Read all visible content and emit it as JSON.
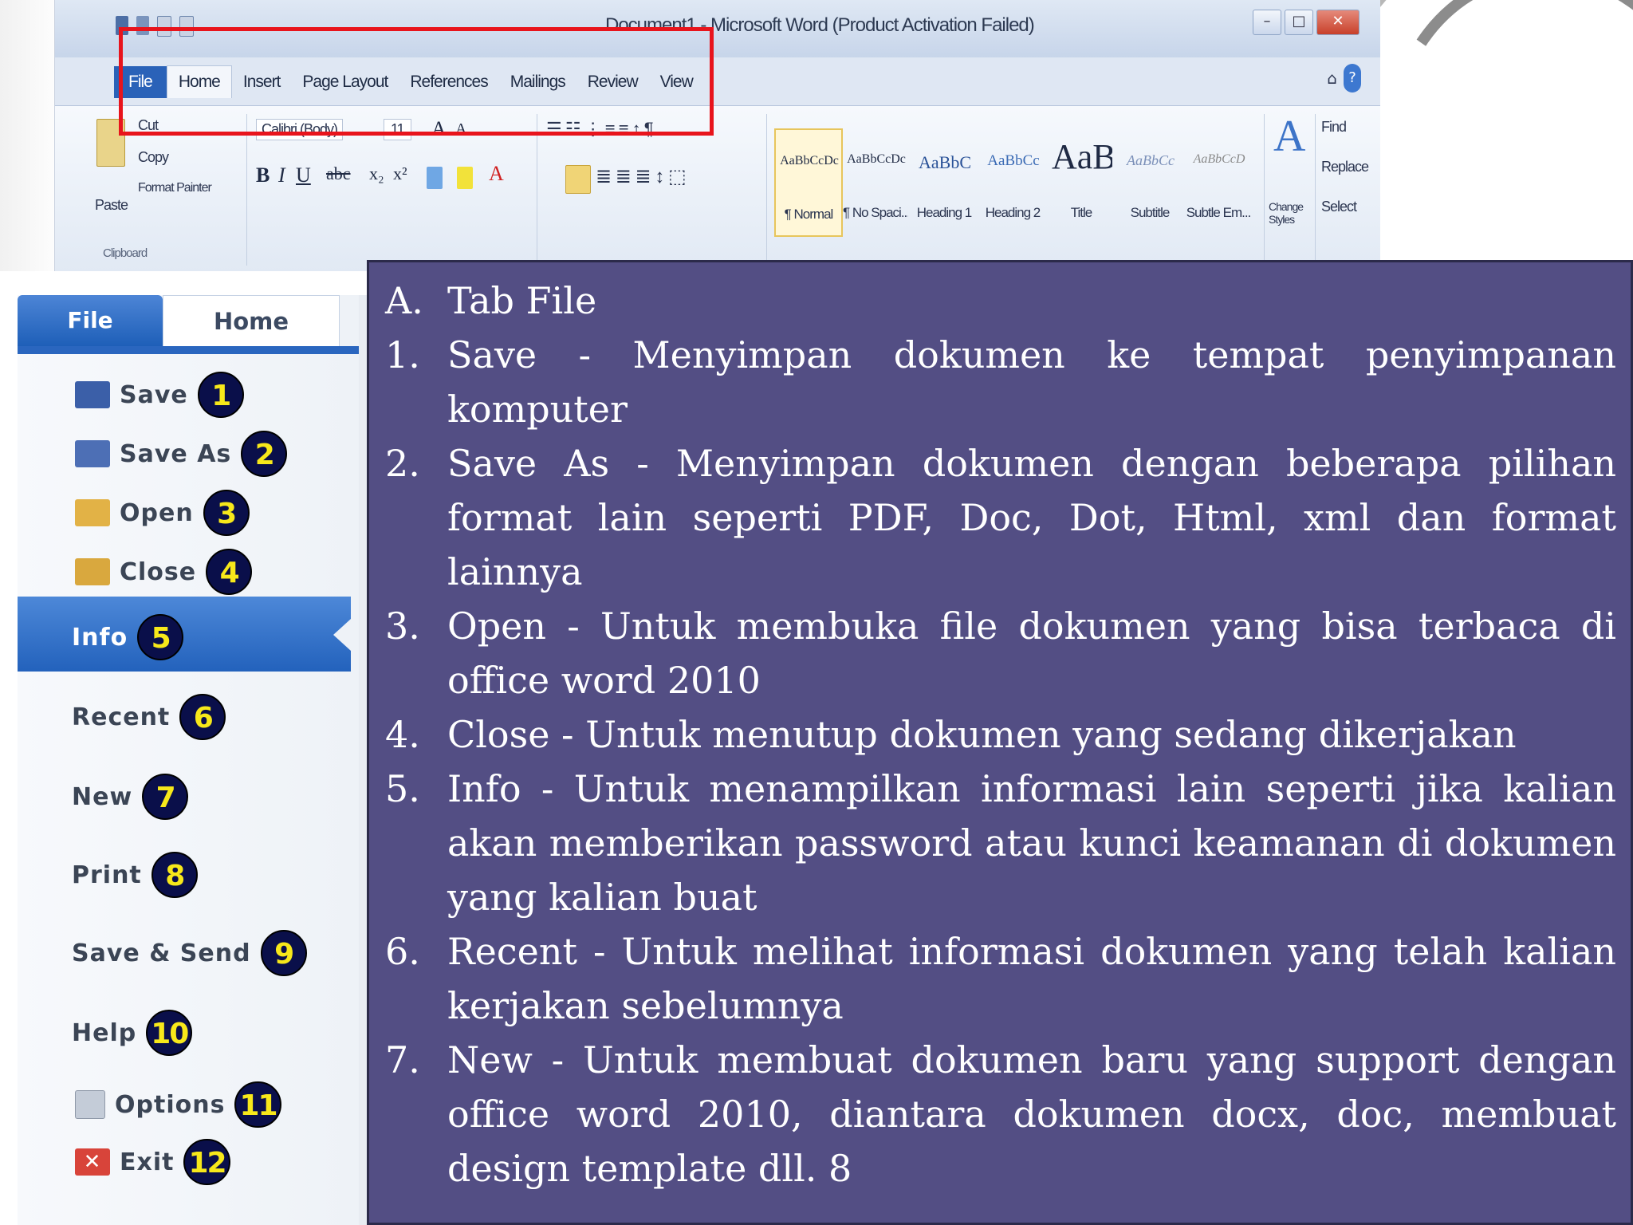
{
  "word_window": {
    "title": "Document1 - Microsoft Word (Product Activation Failed)",
    "tabs": [
      "File",
      "Home",
      "Insert",
      "Page Layout",
      "References",
      "Mailings",
      "Review",
      "View"
    ],
    "clipboard": {
      "paste": "Paste",
      "cut": "Cut",
      "copy": "Copy",
      "format_painter": "Format Painter",
      "group": "Clipboard"
    },
    "font": {
      "name": "Calibri (Body)",
      "size": "11"
    },
    "styles": [
      {
        "sample": "AaBbCcDc",
        "name": "¶ Normal"
      },
      {
        "sample": "AaBbCcDc",
        "name": "¶ No Spaci..."
      },
      {
        "sample": "AaBbC",
        "name": "Heading 1"
      },
      {
        "sample": "AaBbCc",
        "name": "Heading 2"
      },
      {
        "sample": "AaB",
        "name": "Title"
      },
      {
        "sample": "AaBbCc",
        "name": "Subtitle"
      },
      {
        "sample": "AaBbCcD",
        "name": "Subtle Em..."
      }
    ],
    "change_styles": "Change Styles",
    "editing": {
      "find": "Find",
      "replace": "Replace",
      "select": "Select"
    }
  },
  "file_menu": {
    "tab_file": "File",
    "tab_home": "Home",
    "items": [
      {
        "label": "Save",
        "badge": "1",
        "icon": "save-icon",
        "color": "#3b5fa8"
      },
      {
        "label": "Save As",
        "badge": "2",
        "icon": "save-as-icon",
        "color": "#4d6fb5"
      },
      {
        "label": "Open",
        "badge": "3",
        "icon": "open-folder-icon",
        "color": "#e2b246"
      },
      {
        "label": "Close",
        "badge": "4",
        "icon": "close-folder-icon",
        "color": "#d9a83e"
      },
      {
        "label": "Info",
        "badge": "5"
      },
      {
        "label": "Recent",
        "badge": "6"
      },
      {
        "label": "New",
        "badge": "7"
      },
      {
        "label": "Print",
        "badge": "8"
      },
      {
        "label": "Save & Send",
        "badge": "9"
      },
      {
        "label": "Help",
        "badge": "10"
      },
      {
        "label": "Options",
        "badge": "11",
        "icon": "options-icon",
        "color": "#9aa4b4"
      },
      {
        "label": "Exit",
        "badge": "12",
        "icon": "exit-icon",
        "color": "#d8443a"
      }
    ]
  },
  "panel": {
    "background": "#534e84",
    "heading": {
      "marker": "A.",
      "text": "Tab File"
    },
    "items": [
      {
        "num": "1.",
        "text": "Save - Menyimpan dokumen ke tempat penyimpanan komputer"
      },
      {
        "num": "2.",
        "text": "Save As - Menyimpan dokumen dengan beberapa pilihan format lain seperti PDF, Doc, Dot, Html, xml dan format lainnya"
      },
      {
        "num": "3.",
        "text": "Open - Untuk membuka file dokumen yang bisa terbaca di office word 2010"
      },
      {
        "num": "4.",
        "text": "Close - Untuk menutup dokumen yang sedang dikerjakan"
      },
      {
        "num": "5.",
        "text": "Info - Untuk menampilkan informasi lain seperti jika kalian akan memberikan password atau kunci keamanan di dokumen yang kalian buat"
      },
      {
        "num": "6.",
        "text": "Recent - Untuk melihat informasi dokumen yang telah kalian kerjakan sebelumnya"
      },
      {
        "num": "7.",
        "text": "New - Untuk membuat dokumen baru yang support dengan office word 2010, diantara dokumen docx, doc, membuat design template dll. 8"
      }
    ]
  }
}
